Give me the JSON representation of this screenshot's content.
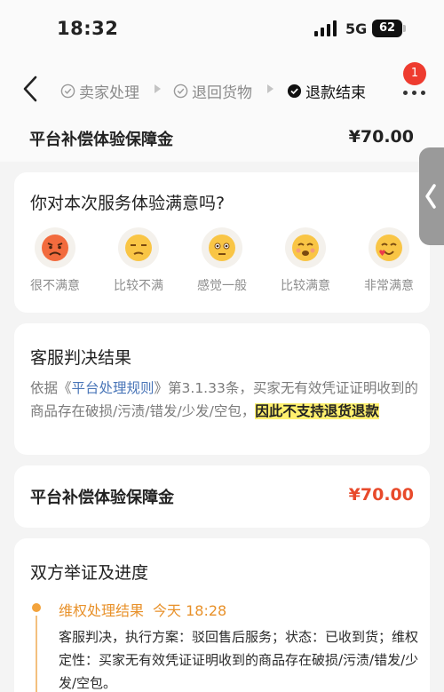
{
  "status_bar": {
    "time": "18:32",
    "network": "5G",
    "battery": "62"
  },
  "nav": {
    "steps": [
      {
        "label": "卖家处理",
        "state": "done"
      },
      {
        "label": "退回货物",
        "state": "done"
      },
      {
        "label": "退款结束",
        "state": "current"
      }
    ],
    "badge_count": "1"
  },
  "top_row": {
    "label": "平台补偿体验保障金",
    "amount": "¥70.00"
  },
  "survey": {
    "title": "你对本次服务体验满意吗?",
    "options": [
      {
        "label": "很不满意",
        "icon": "angry-face-icon"
      },
      {
        "label": "比较不满",
        "icon": "unamused-face-icon"
      },
      {
        "label": "感觉一般",
        "icon": "neutral-face-icon"
      },
      {
        "label": "比较满意",
        "icon": "smiling-face-icon"
      },
      {
        "label": "非常满意",
        "icon": "heart-eyes-face-icon"
      }
    ]
  },
  "verdict": {
    "title": "客服判决结果",
    "text_prefix": "依据《",
    "rule_link": "平台处理规则",
    "text_mid": "》第3.1.33条，买家无有效凭证证明收到的商品存在破损/污渍/错发/少发/空包，",
    "highlight": "因此不支持退货退款"
  },
  "compensation": {
    "label": "平台补偿体验保障金",
    "amount": "¥70.00"
  },
  "evidence": {
    "title": "双方举证及进度",
    "timeline": [
      {
        "title": "维权处理结果",
        "time": "今天 18:28",
        "body": "客服判决，执行方案：驳回售后服务；状态：已收到货；维权定性：买家无有效凭证证明收到的商品存在破损/污渍/错发/少发/空包。"
      }
    ]
  },
  "colors": {
    "accent_orange": "#e8912a",
    "price_red": "#e84a2b",
    "link_blue": "#4a76b8",
    "highlight_yellow": "#fff06e",
    "badge_red": "#ee3b2f"
  }
}
